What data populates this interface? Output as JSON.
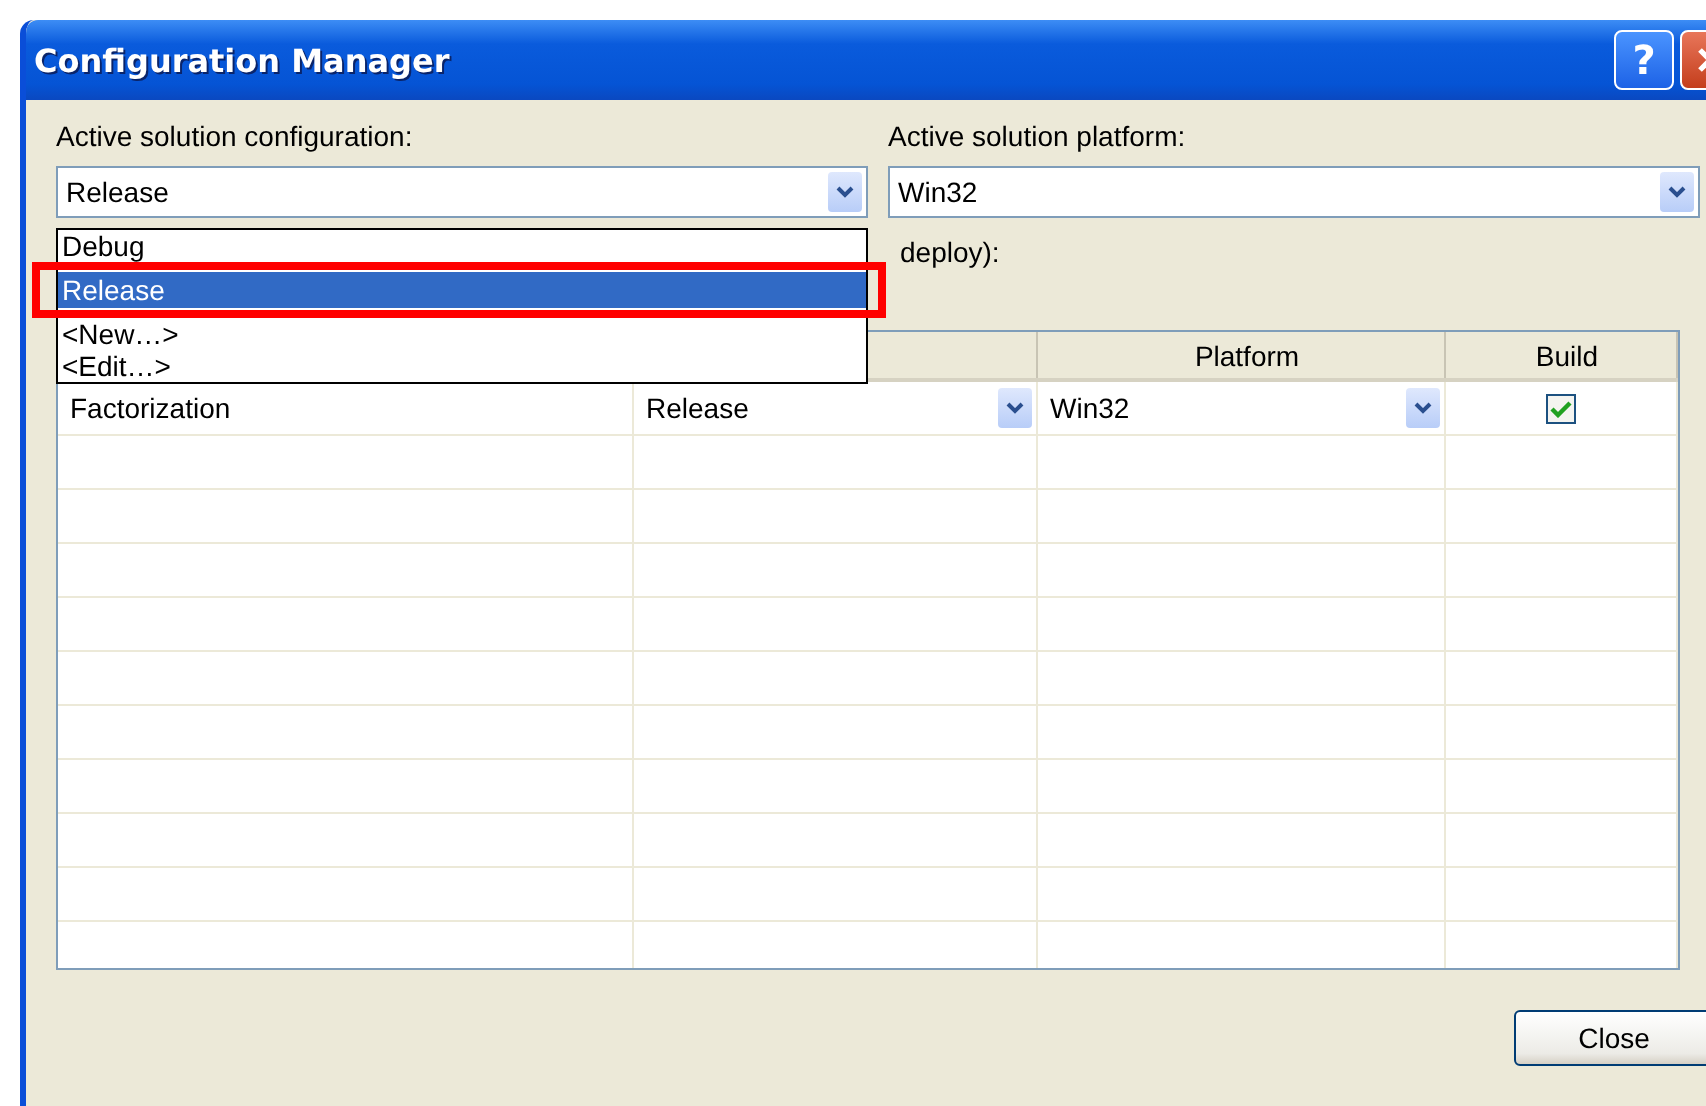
{
  "window": {
    "title": "Configuration Manager",
    "help_label": "?"
  },
  "active_configuration": {
    "label": "Active solution configuration:",
    "value": "Release",
    "expanded": true,
    "options": [
      {
        "label": "Debug",
        "selected": false
      },
      {
        "label": "Release",
        "selected": true
      },
      {
        "label": "<New…>",
        "selected": false
      },
      {
        "label": "<Edit…>",
        "selected": false
      }
    ]
  },
  "active_platform": {
    "label": "Active solution platform:",
    "value": "Win32"
  },
  "project_contexts": {
    "label": "deploy):",
    "columns": [
      "Platform",
      "Build"
    ],
    "rows": [
      {
        "project": "Factorization",
        "configuration": "Release",
        "platform": "Win32",
        "build": true
      }
    ]
  },
  "buttons": [
    "Close"
  ]
}
